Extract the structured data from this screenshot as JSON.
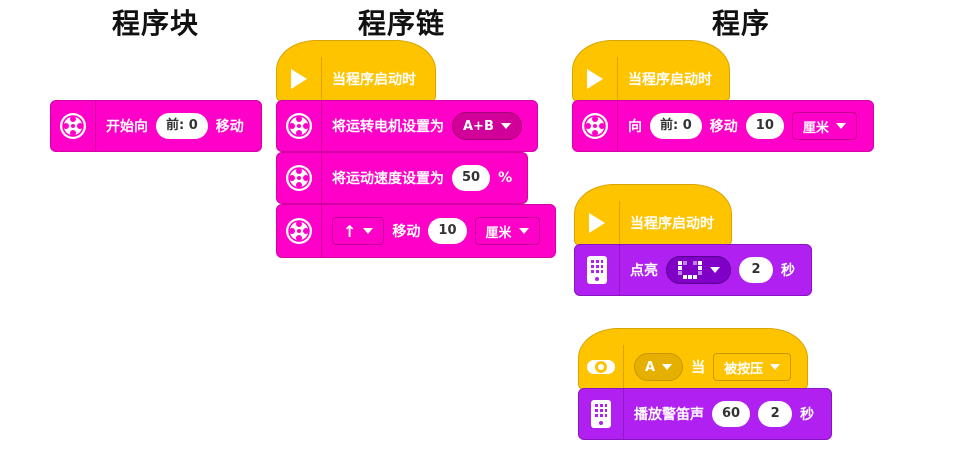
{
  "headings": {
    "block": "程序块",
    "chain": "程序链",
    "program": "程序"
  },
  "block_single": {
    "label_start": "开始向",
    "direction_value": "前: 0",
    "label_move": "移动"
  },
  "chain": {
    "hat_label": "当程序启动时",
    "set_motors_label": "将运转电机设置为",
    "set_motors_value": "A+B",
    "set_speed_label": "将运动速度设置为",
    "set_speed_value": "50",
    "set_speed_unit": "%",
    "move_direction": "↑",
    "move_label": "移动",
    "move_value": "10",
    "move_unit": "厘米"
  },
  "program1": {
    "hat_label": "当程序启动时",
    "label_dir": "向",
    "direction_value": "前: 0",
    "label_move": "移动",
    "move_value": "10",
    "move_unit": "厘米"
  },
  "program2": {
    "hat_label": "当程序启动时",
    "light_label": "点亮",
    "duration_value": "2",
    "duration_unit": "秒"
  },
  "program3": {
    "button_value": "A",
    "when_label": "当",
    "state_value": "被按压",
    "beep_label": "播放警笛声",
    "note_value": "60",
    "beep_duration": "2",
    "beep_unit": "秒"
  },
  "colors": {
    "motion": "#ff00c8",
    "events": "#ffc400",
    "light": "#b020f0"
  },
  "icons": [
    "motor-icon",
    "play-icon",
    "hub-icon",
    "button-icon"
  ]
}
